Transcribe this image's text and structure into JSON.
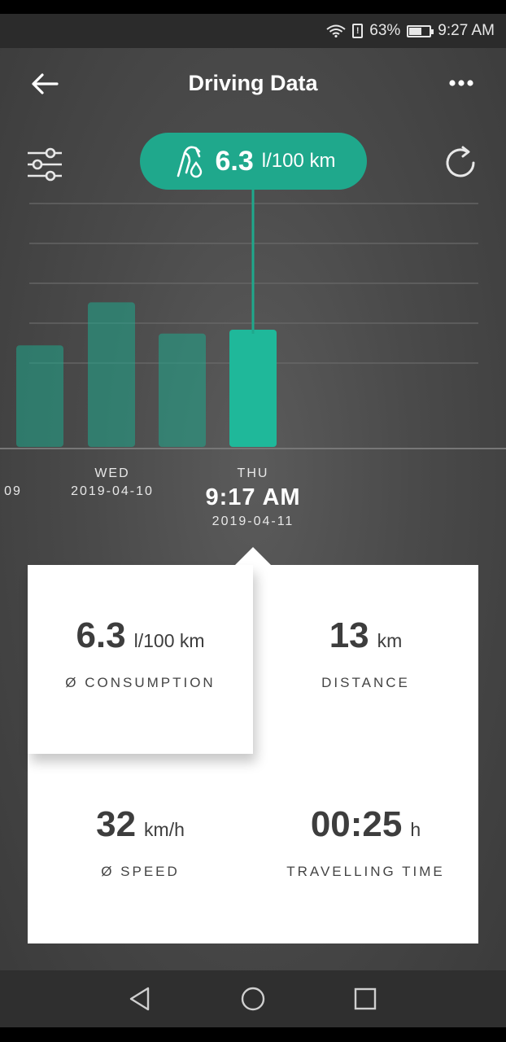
{
  "status_bar": {
    "battery_percent_text": "63%",
    "battery_level": 0.63,
    "time": "9:27 AM",
    "icons": [
      "wifi-icon",
      "battery-alert-icon",
      "battery-icon"
    ]
  },
  "header": {
    "title": "Driving Data",
    "back_icon": "arrow-left-icon",
    "more_icon": "more-dots-icon"
  },
  "toolbar": {
    "filter_icon": "sliders-icon",
    "refresh_icon": "refresh-icon"
  },
  "bubble": {
    "icon": "fuel-drop-icon",
    "value": "6.3",
    "unit": "l/100 km"
  },
  "chart": {
    "accent_color": "#1fa88c",
    "selected_color": "#1fb89a",
    "days": [
      {
        "day": "",
        "date": "09",
        "time": "",
        "selected": false,
        "level": 0.52
      },
      {
        "day": "WED",
        "date": "2019-04-10",
        "time": "",
        "selected": false,
        "level": 0.74
      },
      {
        "day": "",
        "date": "",
        "time": "",
        "selected": false,
        "level": 0.58
      },
      {
        "day": "THU",
        "date": "2019-04-11",
        "time": "9:17 AM",
        "selected": true,
        "level": 0.6
      }
    ]
  },
  "stats": {
    "consumption": {
      "value": "6.3",
      "unit": "l/100 km",
      "label": "Ø CONSUMPTION"
    },
    "distance": {
      "value": "13",
      "unit": "km",
      "label": "DISTANCE"
    },
    "speed": {
      "value": "32",
      "unit": "km/h",
      "label": "Ø SPEED"
    },
    "travel_time": {
      "value": "00:25",
      "unit": "h",
      "label": "TRAVELLING TIME"
    }
  },
  "nav": {
    "back_icon": "nav-back-icon",
    "home_icon": "nav-home-icon",
    "recents_icon": "nav-recents-icon"
  }
}
